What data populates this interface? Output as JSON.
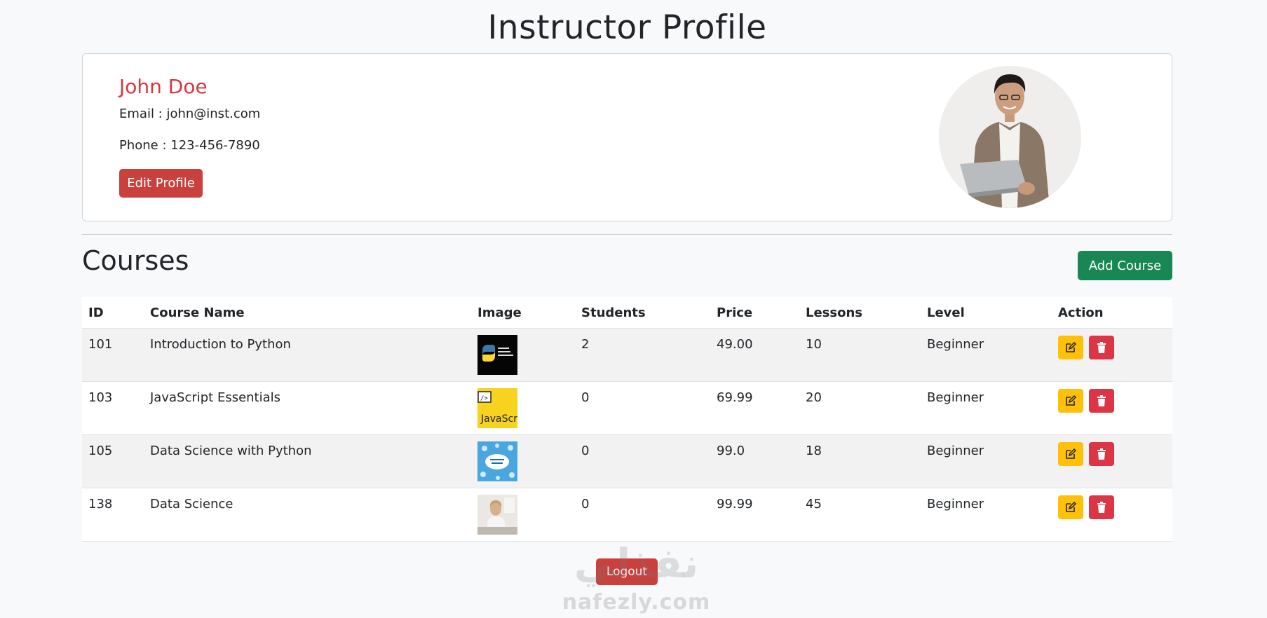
{
  "page": {
    "title": "Instructor Profile"
  },
  "profile": {
    "name": "John Doe",
    "email_line": "Email : john@inst.com",
    "phone_line": "Phone : 123-456-7890",
    "edit_label": "Edit Profile",
    "avatar_icon": "instructor-avatar-photo"
  },
  "courses": {
    "title": "Courses",
    "add_label": "Add Course",
    "headers": [
      "ID",
      "Course Name",
      "Image",
      "Students",
      "Price",
      "Lessons",
      "Level",
      "Action"
    ],
    "rows": [
      {
        "id": "101",
        "name": "Introduction to Python",
        "students": "2",
        "price": "49.00",
        "lessons": "10",
        "level": "Beginner",
        "thumb_icon": "python-course-thumbnail"
      },
      {
        "id": "103",
        "name": "JavaScript Essentials",
        "students": "0",
        "price": "69.99",
        "lessons": "20",
        "level": "Beginner",
        "thumb_icon": "javascript-course-thumbnail",
        "thumb_text": "JavaScr"
      },
      {
        "id": "105",
        "name": "Data Science with Python",
        "students": "0",
        "price": "99.0",
        "lessons": "18",
        "level": "Beginner",
        "thumb_icon": "data-science-course-thumbnail"
      },
      {
        "id": "138",
        "name": "Data Science",
        "students": "0",
        "price": "99.99",
        "lessons": "45",
        "level": "Beginner",
        "thumb_icon": "person-at-desk-thumbnail"
      }
    ]
  },
  "footer": {
    "logout_label": "Logout"
  },
  "watermark": {
    "arabic": "نفذلي",
    "latin": "nafezly.com"
  },
  "colors": {
    "danger": "#dc3545",
    "warning": "#ffc107",
    "success": "#198754",
    "name": "#d9363e"
  }
}
